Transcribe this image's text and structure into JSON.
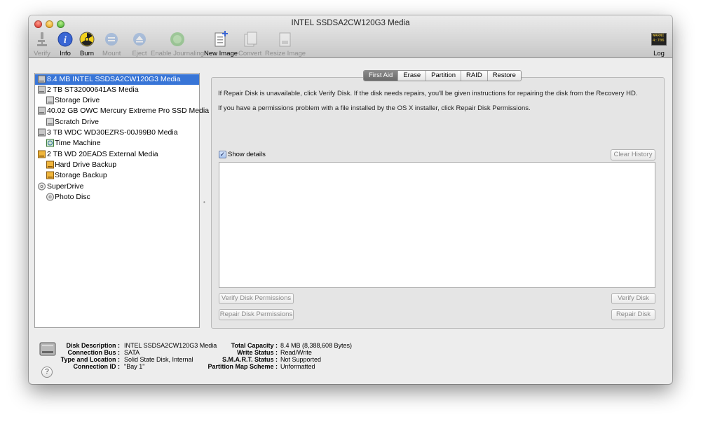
{
  "window": {
    "title": "INTEL SSDSA2CW120G3 Media"
  },
  "toolbar": {
    "verify": "Verify",
    "info": "Info",
    "burn": "Burn",
    "mount": "Mount",
    "eject": "Eject",
    "enable_journaling": "Enable Journaling",
    "new_image": "New Image",
    "convert": "Convert",
    "resize_image": "Resize Image",
    "log": "Log",
    "log_icon_text": [
      "WARNI",
      "4:706"
    ]
  },
  "sidebar": {
    "items": [
      {
        "label": "8.4 MB INTEL SSDSA2CW120G3 Media",
        "icon": "internal-disk-icon",
        "level": 0,
        "selected": true
      },
      {
        "label": "2 TB ST32000641AS Media",
        "icon": "internal-disk-icon",
        "level": 0
      },
      {
        "label": "Storage Drive",
        "icon": "volume-icon",
        "level": 1
      },
      {
        "label": "40.02 GB OWC Mercury Extreme Pro SSD Media",
        "icon": "internal-disk-icon",
        "level": 0
      },
      {
        "label": "Scratch Drive",
        "icon": "volume-icon",
        "level": 1
      },
      {
        "label": "3 TB WDC WD30EZRS-00J99B0 Media",
        "icon": "internal-disk-icon",
        "level": 0
      },
      {
        "label": "Time Machine",
        "icon": "time-machine-icon",
        "level": 1
      },
      {
        "label": "2 TB WD 20EADS External Media",
        "icon": "external-disk-icon",
        "level": 0
      },
      {
        "label": "Hard Drive Backup",
        "icon": "external-disk-icon",
        "level": 1
      },
      {
        "label": "Storage Backup",
        "icon": "external-disk-icon",
        "level": 1
      },
      {
        "label": "SuperDrive",
        "icon": "optical-drive-icon",
        "level": 0
      },
      {
        "label": "Photo Disc",
        "icon": "optical-drive-icon",
        "level": 1
      }
    ]
  },
  "tabs": [
    {
      "label": "First Aid",
      "active": true
    },
    {
      "label": "Erase"
    },
    {
      "label": "Partition"
    },
    {
      "label": "RAID"
    },
    {
      "label": "Restore"
    }
  ],
  "first_aid": {
    "info1": "If Repair Disk is unavailable, click Verify Disk. If the disk needs repairs, you'll be given instructions for repairing the disk from the Recovery HD.",
    "info2": "If you have a permissions problem with a file installed by the OS X installer, click Repair Disk Permissions.",
    "show_details": "Show details",
    "show_details_checked": true,
    "clear_history": "Clear History",
    "verify_permissions": "Verify Disk Permissions",
    "repair_permissions": "Repair Disk Permissions",
    "verify_disk": "Verify Disk",
    "repair_disk": "Repair Disk"
  },
  "disk_info": {
    "left": [
      {
        "label": "Disk Description :",
        "value": "INTEL SSDSA2CW120G3 Media"
      },
      {
        "label": "Connection Bus :",
        "value": "SATA"
      },
      {
        "label": "Type and Location :",
        "value": "Solid State Disk, Internal"
      },
      {
        "label": "Connection ID :",
        "value": "\"Bay 1\""
      }
    ],
    "right": [
      {
        "label": "Total Capacity :",
        "value": "8.4 MB (8,388,608 Bytes)"
      },
      {
        "label": "Write Status :",
        "value": "Read/Write"
      },
      {
        "label": "S.M.A.R.T. Status :",
        "value": "Not Supported"
      },
      {
        "label": "Partition Map Scheme :",
        "value": "Unformatted"
      }
    ]
  },
  "help": "?",
  "splitter": "•",
  "colors": {
    "selection": "#3875d7",
    "window_bg": "#ededed"
  }
}
